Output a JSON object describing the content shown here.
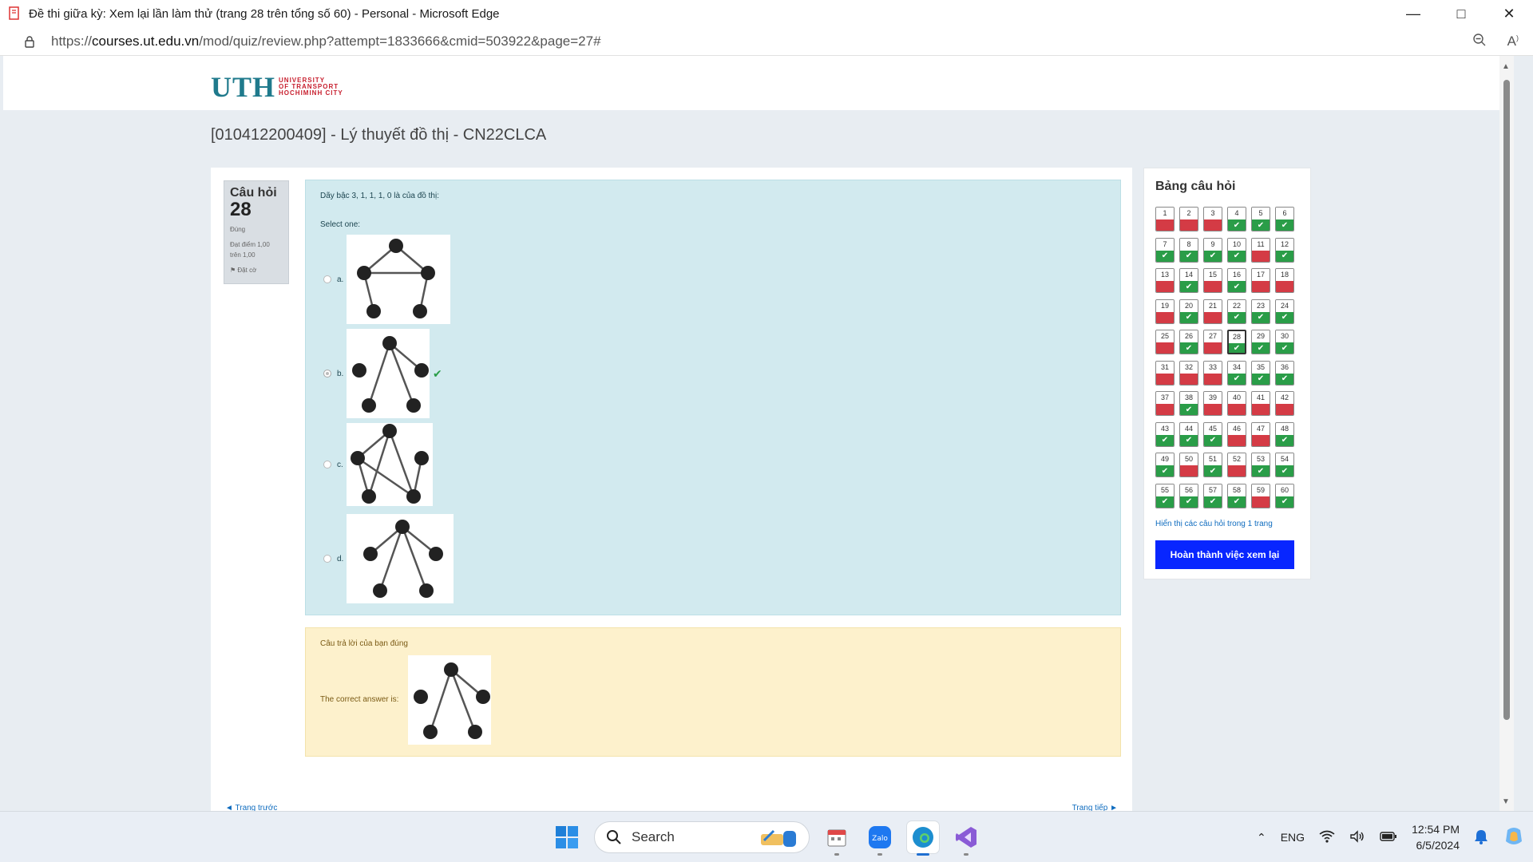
{
  "window": {
    "title": "Đề thi giữa kỳ: Xem lại lần làm thử (trang 28 trên tổng số 60) - Personal - Microsoft Edge",
    "url_prefix": "https://",
    "url_domain": "courses.ut.edu.vn",
    "url_path": "/mod/quiz/review.php?attempt=1833666&cmid=503922&page=27#"
  },
  "header": {
    "logo_text": "UTH",
    "logo_sub_1": "UNIVERSITY",
    "logo_sub_2": "OF TRANSPORT",
    "logo_sub_3": "HOCHIMINH CITY"
  },
  "course_title": "[010412200409] - Lý thuyết đồ thị - CN22CLCA",
  "question_info": {
    "label": "Câu hỏi",
    "number": "28",
    "state": "Đúng",
    "mark_line1": "Đạt điểm 1,00",
    "mark_line2": "trên 1,00",
    "flag": "Đặt cờ"
  },
  "question": {
    "text": "Dãy bậc 3, 1, 1, 1, 0 là của đồ thị:",
    "select_one": "Select one:",
    "options": [
      {
        "letter": "a."
      },
      {
        "letter": "b.",
        "selected": true,
        "correct_mark": "✔"
      },
      {
        "letter": "c."
      },
      {
        "letter": "d."
      }
    ]
  },
  "feedback": {
    "result": "Câu trả lời của bạn đúng",
    "correct_answer": "The correct answer is:"
  },
  "navigation": {
    "prev": "◄ Trang trước",
    "next": "Trang tiếp ►"
  },
  "quiz_nav": {
    "title": "Bảng câu hỏi",
    "current": 28,
    "questions": [
      {
        "n": "1",
        "s": "bad"
      },
      {
        "n": "2",
        "s": "bad"
      },
      {
        "n": "3",
        "s": "bad"
      },
      {
        "n": "4",
        "s": "ok"
      },
      {
        "n": "5",
        "s": "ok"
      },
      {
        "n": "6",
        "s": "ok"
      },
      {
        "n": "7",
        "s": "ok"
      },
      {
        "n": "8",
        "s": "ok"
      },
      {
        "n": "9",
        "s": "ok"
      },
      {
        "n": "10",
        "s": "ok"
      },
      {
        "n": "11",
        "s": "bad"
      },
      {
        "n": "12",
        "s": "ok"
      },
      {
        "n": "13",
        "s": "bad"
      },
      {
        "n": "14",
        "s": "ok"
      },
      {
        "n": "15",
        "s": "bad"
      },
      {
        "n": "16",
        "s": "ok"
      },
      {
        "n": "17",
        "s": "bad"
      },
      {
        "n": "18",
        "s": "bad"
      },
      {
        "n": "19",
        "s": "bad"
      },
      {
        "n": "20",
        "s": "ok"
      },
      {
        "n": "21",
        "s": "bad"
      },
      {
        "n": "22",
        "s": "ok"
      },
      {
        "n": "23",
        "s": "ok"
      },
      {
        "n": "24",
        "s": "ok"
      },
      {
        "n": "25",
        "s": "bad"
      },
      {
        "n": "26",
        "s": "ok"
      },
      {
        "n": "27",
        "s": "bad"
      },
      {
        "n": "28",
        "s": "ok"
      },
      {
        "n": "29",
        "s": "ok"
      },
      {
        "n": "30",
        "s": "ok"
      },
      {
        "n": "31",
        "s": "bad"
      },
      {
        "n": "32",
        "s": "bad"
      },
      {
        "n": "33",
        "s": "bad"
      },
      {
        "n": "34",
        "s": "ok"
      },
      {
        "n": "35",
        "s": "ok"
      },
      {
        "n": "36",
        "s": "ok"
      },
      {
        "n": "37",
        "s": "bad"
      },
      {
        "n": "38",
        "s": "ok"
      },
      {
        "n": "39",
        "s": "bad"
      },
      {
        "n": "40",
        "s": "bad"
      },
      {
        "n": "41",
        "s": "bad"
      },
      {
        "n": "42",
        "s": "bad"
      },
      {
        "n": "43",
        "s": "ok"
      },
      {
        "n": "44",
        "s": "ok"
      },
      {
        "n": "45",
        "s": "ok"
      },
      {
        "n": "46",
        "s": "bad"
      },
      {
        "n": "47",
        "s": "bad"
      },
      {
        "n": "48",
        "s": "ok"
      },
      {
        "n": "49",
        "s": "ok"
      },
      {
        "n": "50",
        "s": "bad"
      },
      {
        "n": "51",
        "s": "ok"
      },
      {
        "n": "52",
        "s": "bad"
      },
      {
        "n": "53",
        "s": "ok"
      },
      {
        "n": "54",
        "s": "ok"
      },
      {
        "n": "55",
        "s": "ok"
      },
      {
        "n": "56",
        "s": "ok"
      },
      {
        "n": "57",
        "s": "ok"
      },
      {
        "n": "58",
        "s": "ok"
      },
      {
        "n": "59",
        "s": "bad"
      },
      {
        "n": "60",
        "s": "ok"
      }
    ],
    "show_all": "Hiển thị các câu hỏi trong 1 trang",
    "finish_button": "Hoàn thành việc xem lại"
  },
  "taskbar": {
    "search_label": "Search",
    "lang": "ENG",
    "time": "12:54 PM",
    "date": "6/5/2024",
    "zalo_label": "Zalo"
  },
  "colors": {
    "correct": "#2a9d48",
    "incorrect": "#d43b45",
    "question_bg": "#d2eaef",
    "feedback_bg": "#fdf1cc",
    "primary_button": "#0826ff"
  }
}
